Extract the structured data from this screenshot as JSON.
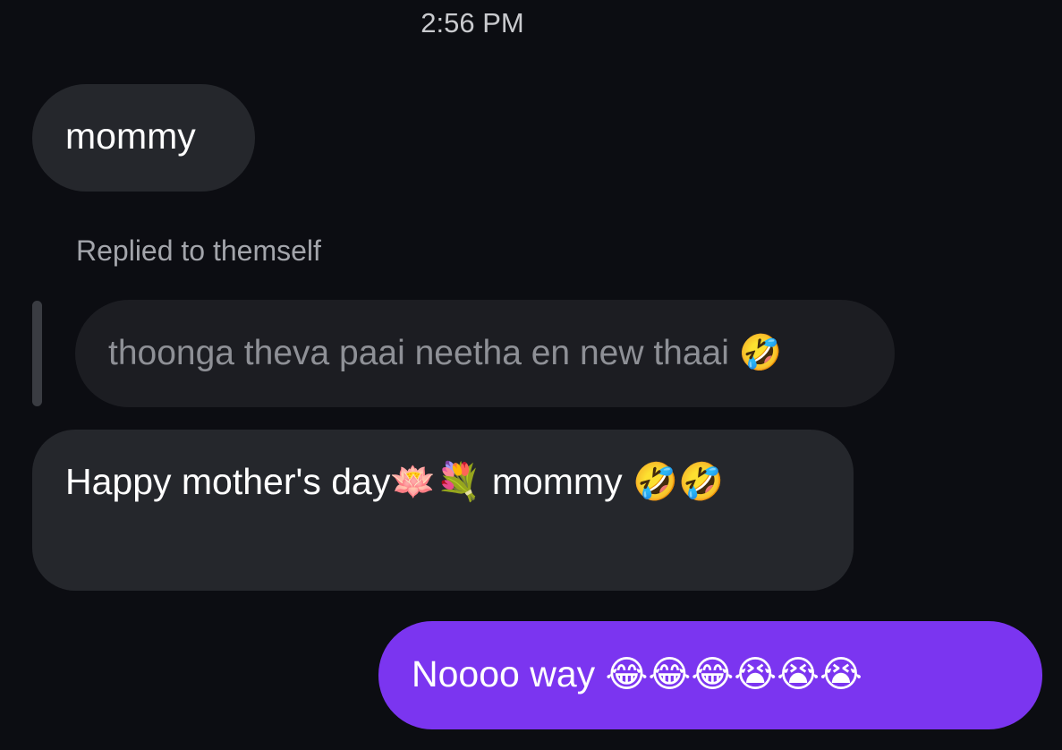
{
  "thread": {
    "timestamp": "2:56 PM",
    "messages": [
      {
        "direction": "incoming",
        "text": "mommy"
      },
      {
        "direction": "incoming",
        "reply_label": "Replied to themself",
        "quoted_text": "thoonga theva paai neetha en new thaai 🤣",
        "text": "Happy mother's day🪷💐 mommy 🤣🤣"
      },
      {
        "direction": "outgoing",
        "text": "Noooo way 😂😂😂😭😭😭"
      }
    ]
  },
  "colors": {
    "background": "#0c0d12",
    "incoming_bubble": "#25272c",
    "quoted_bubble": "#1c1d22",
    "outgoing_bubble": "#7b35f0",
    "timestamp_text": "#c9cace",
    "reply_label_text": "#a3a5ab",
    "quoted_text": "#8e9096"
  }
}
